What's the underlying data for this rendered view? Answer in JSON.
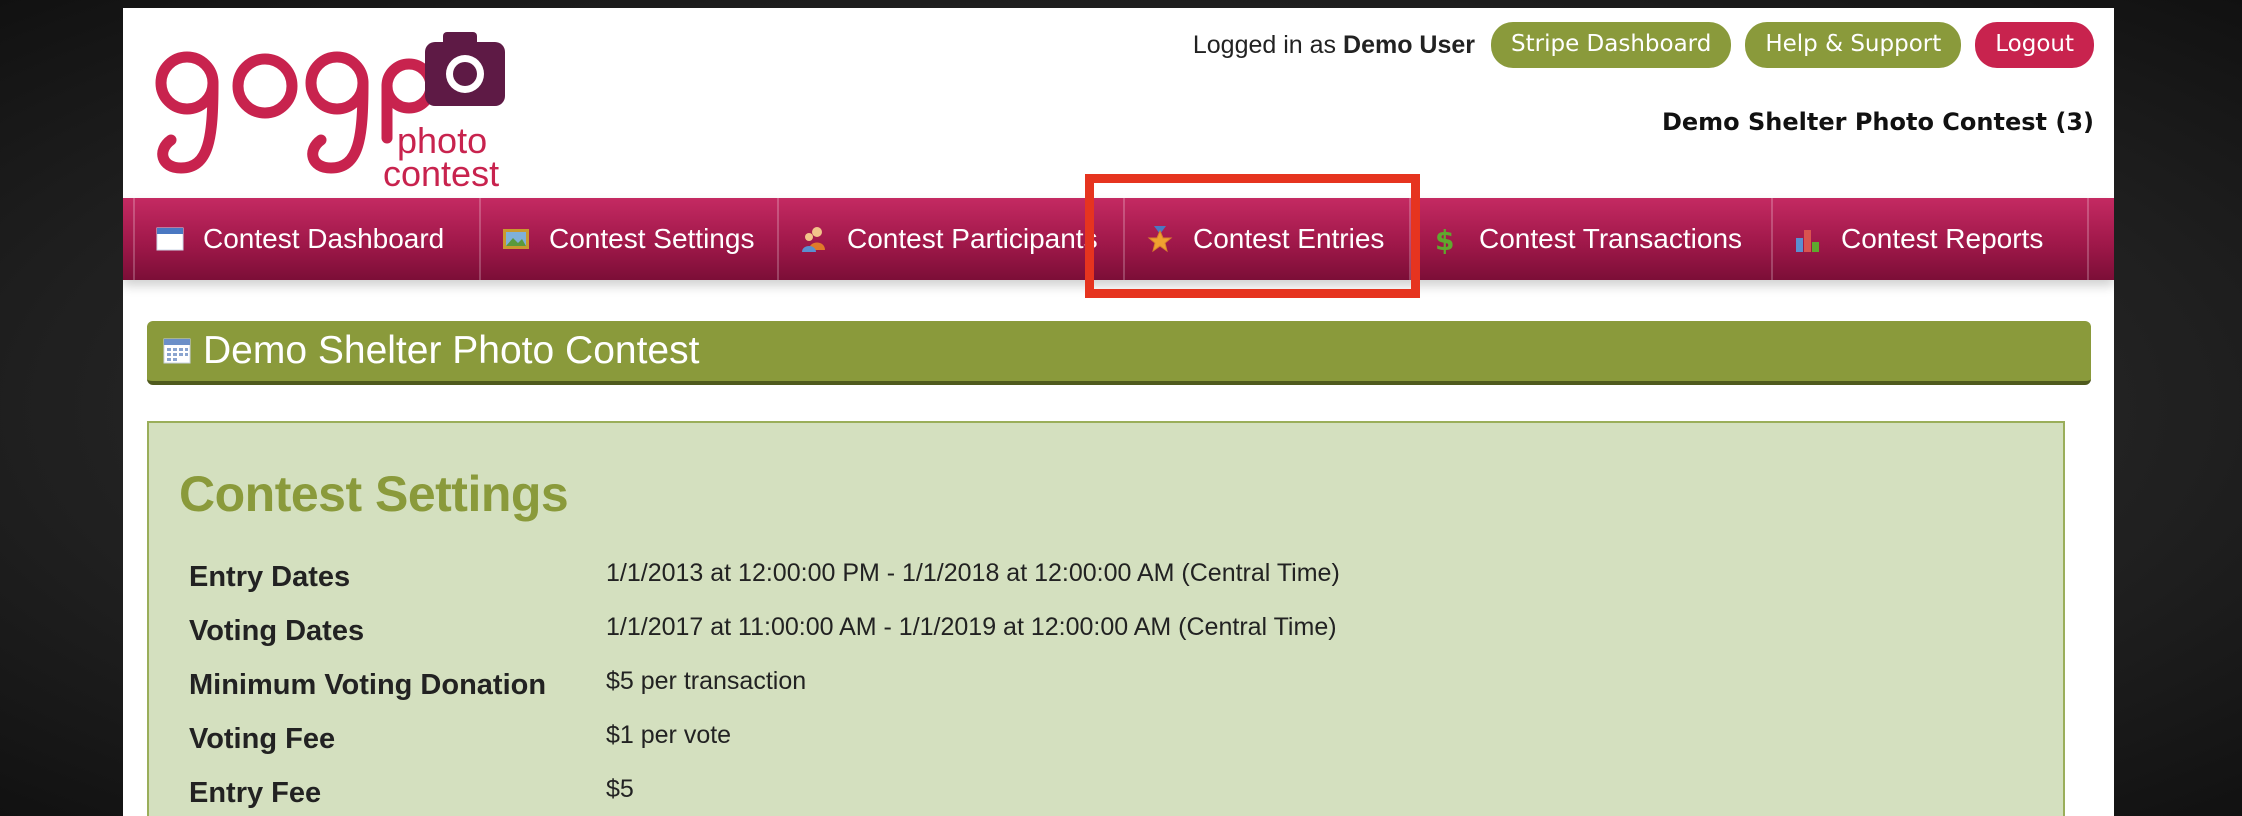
{
  "header": {
    "logged_in_prefix": "Logged in as",
    "user_name": "Demo User",
    "buttons": {
      "stripe": "Stripe Dashboard",
      "help": "Help & Support",
      "logout": "Logout"
    },
    "contest_name": "Demo Shelter Photo Contest (3)"
  },
  "logo": {
    "brand": "gogo",
    "sub1": "photo",
    "sub2": "contest"
  },
  "nav": {
    "items": [
      {
        "label": "Contest Dashboard",
        "icon": "calendar-window-icon"
      },
      {
        "label": "Contest Settings",
        "icon": "picture-frame-icon"
      },
      {
        "label": "Contest Participants",
        "icon": "people-icon"
      },
      {
        "label": "Contest Entries",
        "icon": "star-medal-icon"
      },
      {
        "label": "Contest Transactions",
        "icon": "dollar-icon"
      },
      {
        "label": "Contest Reports",
        "icon": "bar-chart-icon"
      }
    ],
    "highlighted": "Contest Entries"
  },
  "main": {
    "title": "Demo Shelter Photo Contest",
    "settings": {
      "heading": "Contest Settings",
      "rows": [
        {
          "label": "Entry Dates",
          "value": "1/1/2013 at 12:00:00 PM - 1/1/2018 at 12:00:00 AM (Central Time)"
        },
        {
          "label": "Voting Dates",
          "value": "1/1/2017 at 11:00:00 AM - 1/1/2019 at 12:00:00 AM (Central Time)"
        },
        {
          "label": "Minimum Voting Donation",
          "value": "$5 per transaction"
        },
        {
          "label": "Voting Fee",
          "value": "$1 per vote"
        },
        {
          "label": "Entry Fee",
          "value": "$5"
        }
      ]
    }
  },
  "colors": {
    "brand_pink": "#c8234e",
    "olive_green": "#8a9a3b",
    "settings_bg": "#d4e0bf",
    "highlight_red": "#e6341f"
  }
}
